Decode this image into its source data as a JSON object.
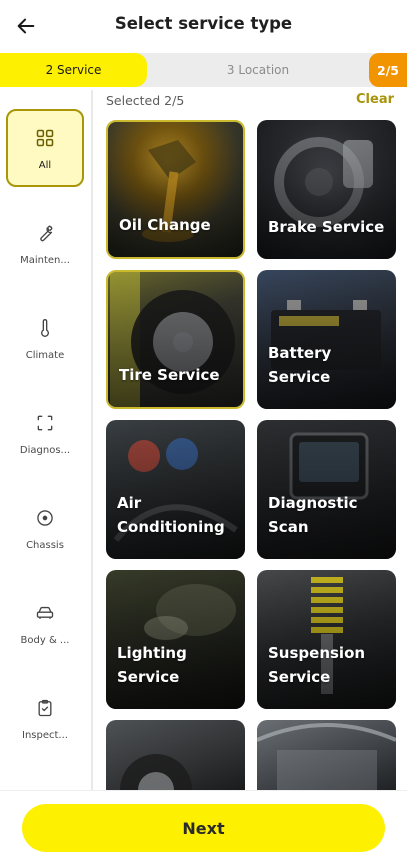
{
  "header": {
    "title": "Select service type",
    "back_icon": "arrow-left-icon"
  },
  "progress": {
    "active_step": "2 Service",
    "next_step": "3 Location",
    "counter": "2/5"
  },
  "sidebar": {
    "items": [
      {
        "label": "All",
        "icon": "grid-icon",
        "active": true
      },
      {
        "label": "Mainten...",
        "icon": "wrench-icon",
        "active": false
      },
      {
        "label": "Climate",
        "icon": "thermometer-icon",
        "active": false
      },
      {
        "label": "Diagnos...",
        "icon": "scan-icon",
        "active": false
      },
      {
        "label": "Chassis",
        "icon": "target-icon",
        "active": false
      },
      {
        "label": "Body & ...",
        "icon": "car-icon",
        "active": false
      },
      {
        "label": "Inspect...",
        "icon": "clipboard-check-icon",
        "active": false
      }
    ]
  },
  "selection": {
    "summary": "Selected 2/5",
    "clear_label": "Clear"
  },
  "services": [
    {
      "name": "Oil Change",
      "selected": true
    },
    {
      "name": "Brake Service",
      "selected": false
    },
    {
      "name": "Tire Service",
      "selected": true
    },
    {
      "name": "Battery Service",
      "selected": false
    },
    {
      "name": "Air Conditioning",
      "selected": false
    },
    {
      "name": "Diagnostic Scan",
      "selected": false
    },
    {
      "name": "Lighting Service",
      "selected": false
    },
    {
      "name": "Suspension Service",
      "selected": false
    },
    {
      "name": "",
      "selected": false
    },
    {
      "name": "",
      "selected": false
    }
  ],
  "footer": {
    "next_label": "Next"
  },
  "colors": {
    "accent": "#fdf000",
    "step_counter": "#f29400",
    "selected_border": "#cbb92e",
    "clear_text": "#a8940a"
  }
}
